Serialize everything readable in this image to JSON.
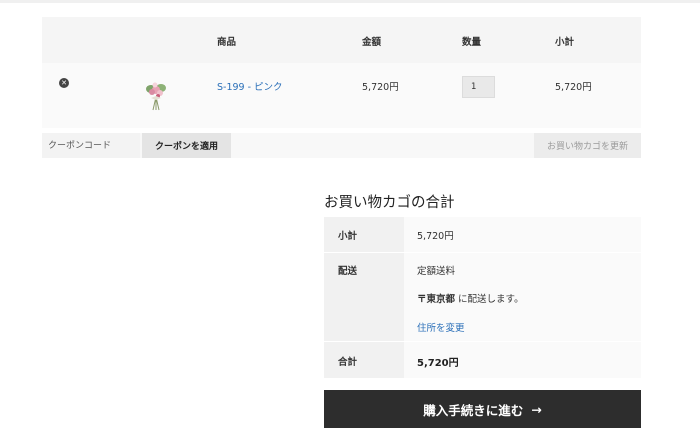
{
  "cart": {
    "headers": {
      "product": "商品",
      "price": "金額",
      "quantity": "数量",
      "subtotal": "小計"
    },
    "items": [
      {
        "name": "S-199 - ピンク",
        "price": "5,720円",
        "quantity": "1",
        "subtotal": "5,720円"
      }
    ]
  },
  "coupon": {
    "placeholder": "クーポンコード",
    "apply_label": "クーポンを適用",
    "update_label": "お買い物カゴを更新"
  },
  "totals": {
    "title": "お買い物カゴの合計",
    "subtotal_label": "小計",
    "subtotal_value": "5,720円",
    "shipping_label": "配送",
    "shipping_method": "定額送料",
    "shipping_prefix": "〒",
    "shipping_region": "東京都",
    "shipping_suffix": " に配送します。",
    "change_address": "住所を変更",
    "total_label": "合計",
    "total_value": "5,720円"
  },
  "checkout": {
    "label": "購入手続きに進む",
    "arrow": "→"
  },
  "colors": {
    "link": "#2a6fb8",
    "checkout_bg": "#2d2d2d"
  },
  "icons": {
    "remove": "close-circle-icon",
    "checkout_arrow": "arrow-right-icon"
  }
}
